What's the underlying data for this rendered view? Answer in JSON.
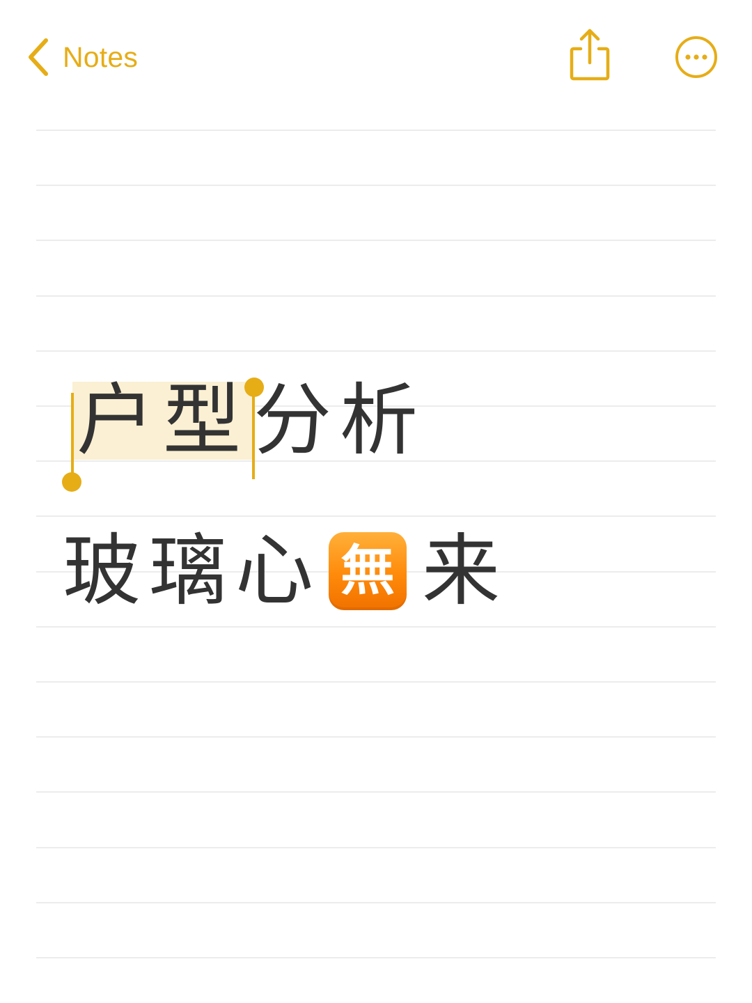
{
  "nav": {
    "back_label": "Notes",
    "share_icon": "share-icon",
    "more_icon": "more-icon",
    "accent_color": "#e6ad17"
  },
  "note": {
    "line1": {
      "selected_text": "户型",
      "rest_text": "分析"
    },
    "line2": {
      "before_emoji": "玻璃心",
      "emoji_char": "無",
      "after_emoji": "来"
    },
    "text_color": "#333333",
    "selection_color": "#fbf0d3",
    "emoji_color": "#ff8a0a"
  }
}
